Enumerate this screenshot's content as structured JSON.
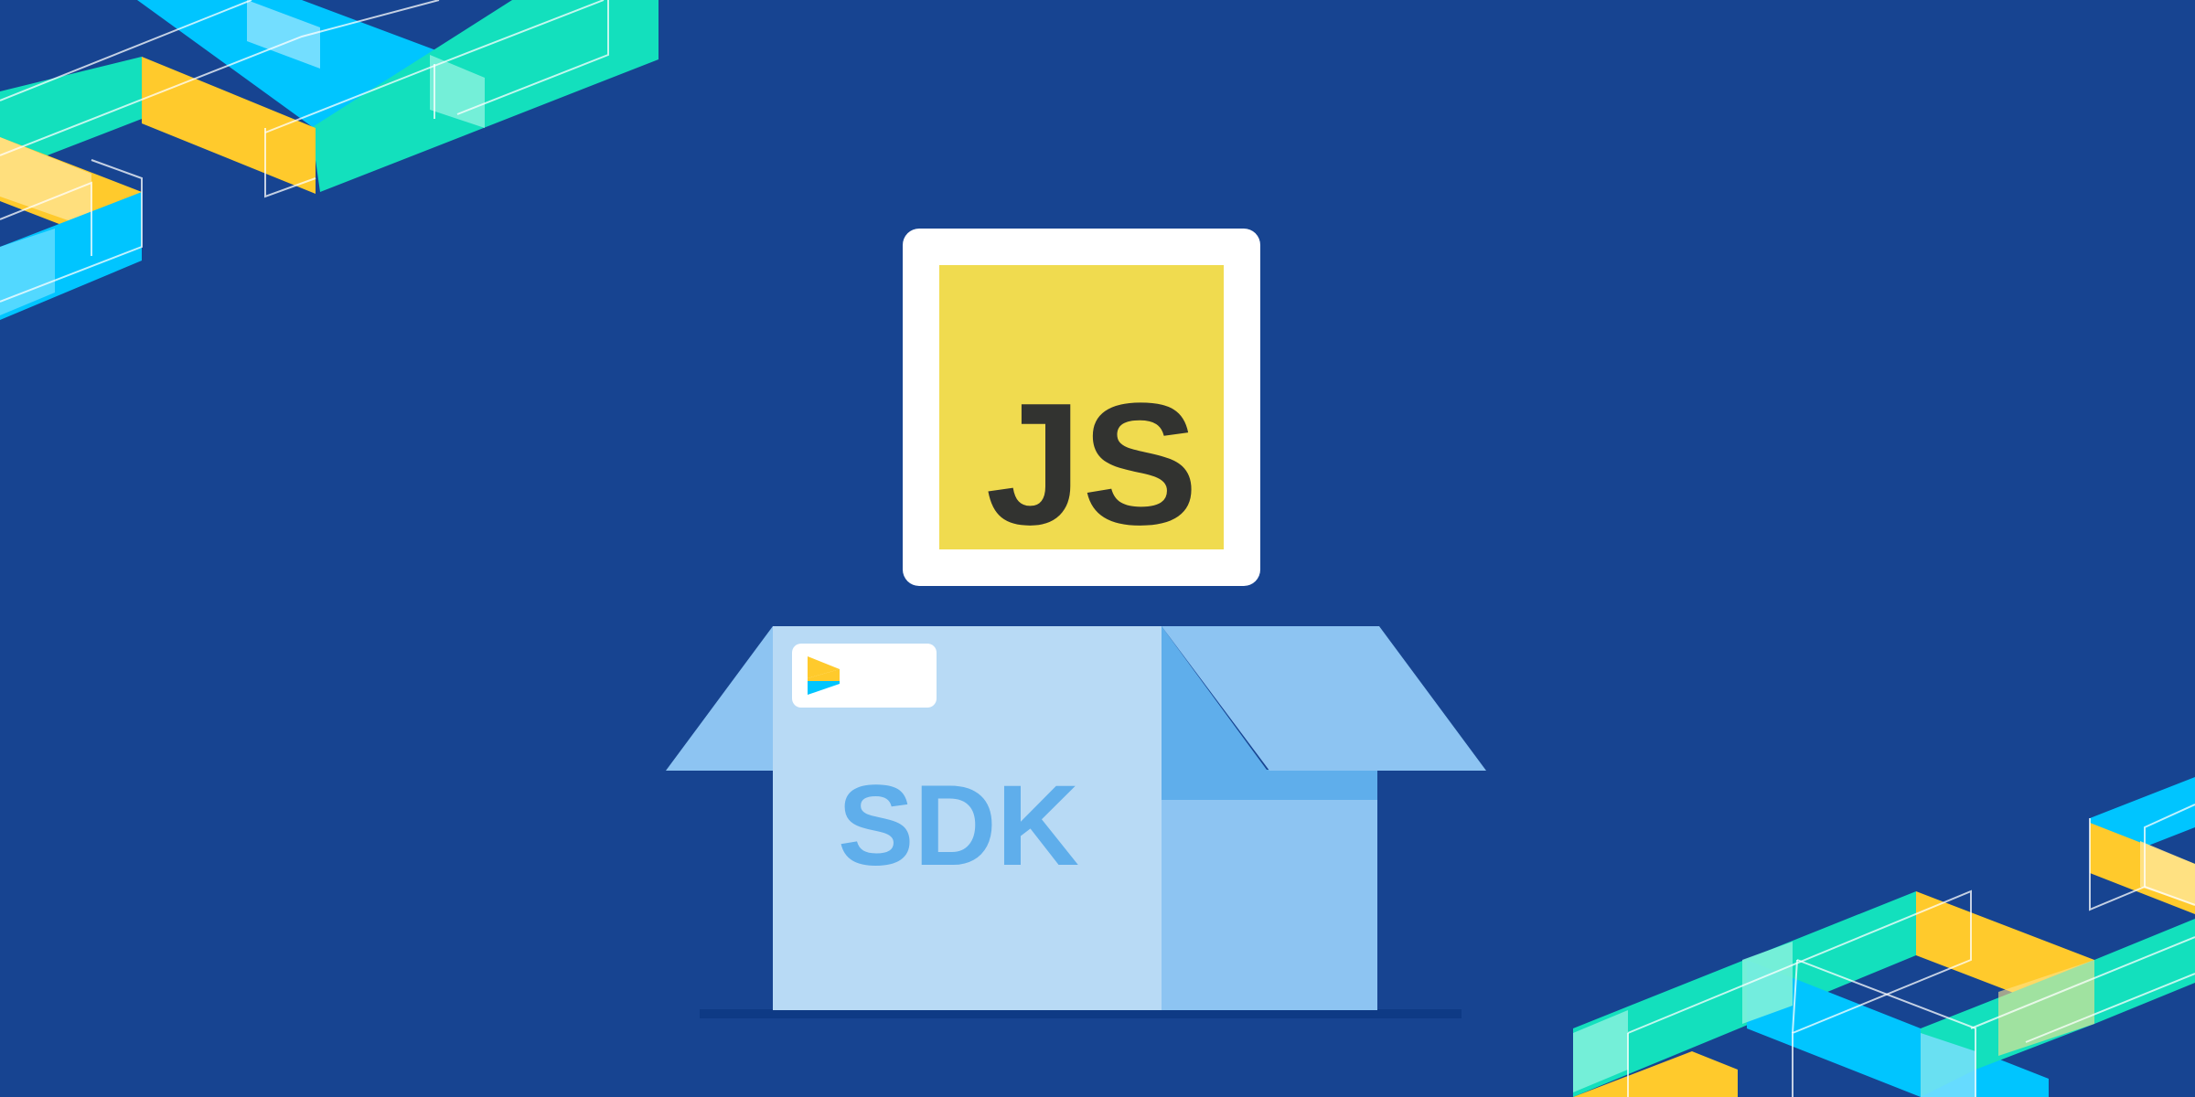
{
  "badge": {
    "text": "JS",
    "icon": "javascript-logo"
  },
  "box": {
    "label": "SDK",
    "tag_icon": "brand-chevron-logo"
  },
  "colors": {
    "background": "#174491",
    "js_yellow": "#F0DB4F",
    "js_text": "#323330",
    "box_front": "#B8DAF5",
    "box_side": "#8DC4F2",
    "box_shadow": "#5FAEEB",
    "sdk_text": "#5FAEEB",
    "stripe_green": "#13E0BD",
    "stripe_yellow": "#FFCA2C",
    "stripe_cyan": "#00C5FF"
  }
}
